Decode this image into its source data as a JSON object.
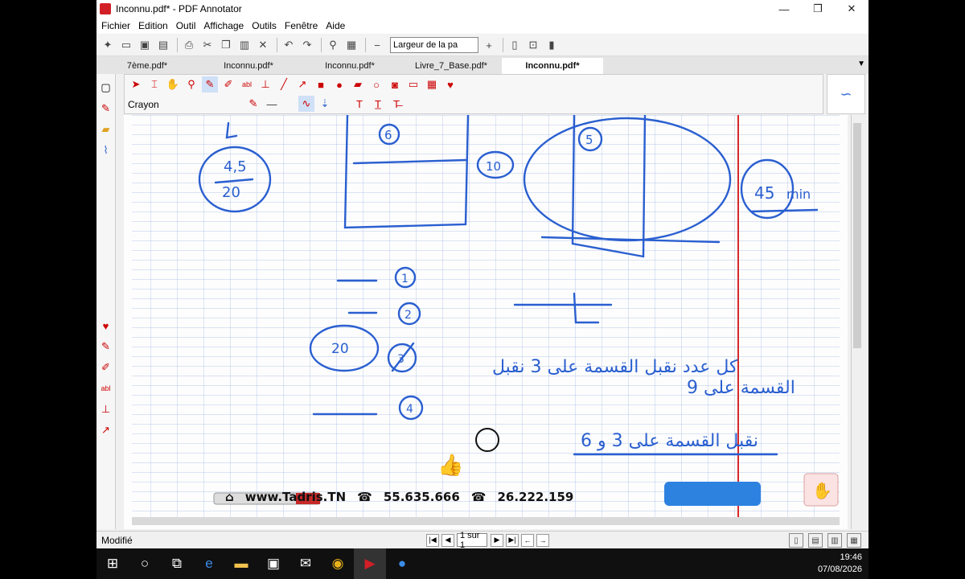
{
  "window": {
    "title": "Inconnu.pdf* - PDF Annotator",
    "minimize": "—",
    "maximize": "❐",
    "close": "✕"
  },
  "menu": [
    "Fichier",
    "Edition",
    "Outil",
    "Affichage",
    "Outils",
    "Fenêtre",
    "Aide"
  ],
  "toolbar": {
    "zoom_value": "Largeur de la pa"
  },
  "tabs": [
    "7ème.pdf*",
    "Inconnu.pdf*",
    "Inconnu.pdf*",
    "Livre_7_Base.pdf*",
    "Inconnu.pdf*"
  ],
  "active_tab_index": 4,
  "annotation_toolbar": {
    "current_tool": "Crayon"
  },
  "document": {
    "handwritten": {
      "fraction_top": "4,5",
      "fraction_bottom": "20",
      "box1_number": "6",
      "box2_number": "5",
      "circled_10": "10",
      "circled_45": "45",
      "min_text": "min",
      "list_1": "1",
      "list_2": "2",
      "list_3": "3",
      "list_4": "4",
      "circled_20": "20",
      "arabic_line1": "كل عدد نقبل القسمة على 3 نقبل",
      "arabic_line2": "القسمة على 9",
      "arabic_line3": "6 نقبل القسمة على 3 و"
    }
  },
  "overlay": {
    "website": "www.Tadris.TN",
    "phone1": "55.635.666",
    "phone2": "26.222.159"
  },
  "status": {
    "text": "Modifié",
    "page_indicator": "1 sur 1"
  },
  "taskbar": {
    "time": "19:46",
    "date": "07/08/2026"
  },
  "colors": {
    "ink": "#2a5fd0",
    "margin_line": "#d42a2a",
    "grid_line": "#9fb7e6",
    "app_accent": "#d21f26"
  }
}
